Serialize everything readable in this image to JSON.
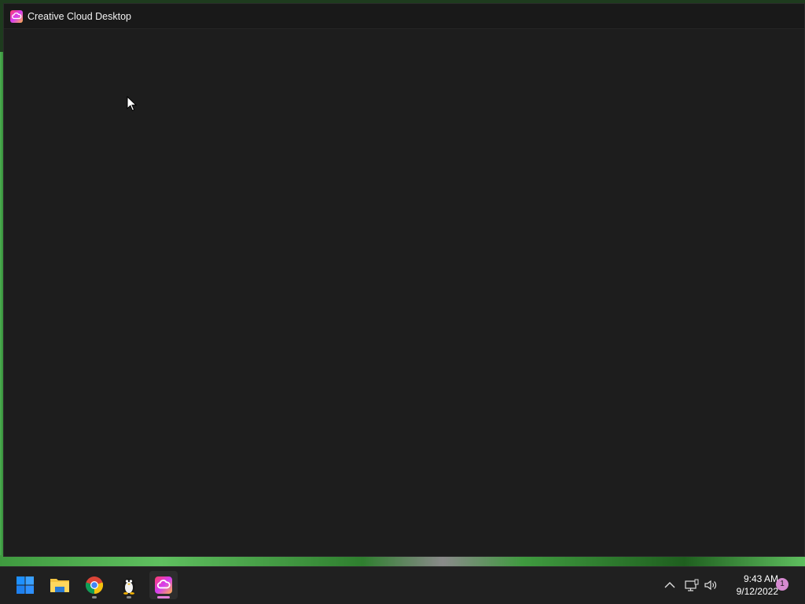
{
  "window": {
    "title": "Creative Cloud Desktop"
  },
  "taskbar": {
    "apps": [
      {
        "name": "start-button",
        "icon": "windows-logo-icon"
      },
      {
        "name": "file-explorer",
        "icon": "folder-icon"
      },
      {
        "name": "chrome",
        "icon": "chrome-icon"
      },
      {
        "name": "linux-tux",
        "icon": "penguin-icon"
      },
      {
        "name": "creative-cloud",
        "icon": "creative-cloud-icon",
        "active": true
      }
    ],
    "tray": {
      "time": "9:43 AM",
      "date": "9/12/2022",
      "notifications": "1"
    }
  },
  "colors": {
    "window_bg": "#1d1d1d",
    "titlebar_bg": "#191919",
    "taskbar_bg": "#202020",
    "desktop_green": "#4caf50",
    "active_indicator": "#e47fd8"
  }
}
